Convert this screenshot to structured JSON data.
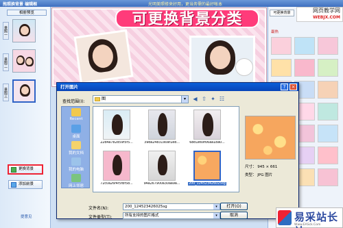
{
  "app": {
    "title": "拖照换背景 编辑框",
    "notice": "光明美照修来好用，更当务需的最好帐本"
  },
  "left_panel": {
    "header": "相册预览",
    "items": [
      {
        "label": "景照一"
      },
      {
        "label": "景照二"
      },
      {
        "label": "景照三"
      }
    ],
    "change_bg_button": "更换背景",
    "add_bg_button": "添加前景",
    "feedback_link": "提意见"
  },
  "banner_text": "可更换背景分类",
  "right_panel": {
    "tab_label": "可更换背景",
    "category_label": "最热"
  },
  "watermark": {
    "top_title": "网页教学网",
    "top_url": "WEBJX.COM",
    "bottom_name": "易采站长站",
    "bottom_url": "Www.EASck.Com"
  },
  "dialog": {
    "title": "打开图片",
    "help": "?",
    "close": "×",
    "look_in_label": "查找范围(I):",
    "look_in_value": "图",
    "places": [
      "Recent",
      "桌面",
      "我的文档",
      "我的电脑",
      "网上邻居"
    ],
    "files": [
      {
        "name": "22d4a782d59f5f5..."
      },
      {
        "name": "39da2483190af1e8..."
      },
      {
        "name": "68d1e69f06aa18a0..."
      },
      {
        "name": "72c0a26f4f5fbf5b..."
      },
      {
        "name": "94a267900a30aa9a..."
      },
      {
        "name": "200_124523426025sg"
      }
    ],
    "preview": {
      "size_label": "尺寸：",
      "size_value": "945 × 661",
      "type_label": "类型：",
      "type_value": "JPG 图片"
    },
    "filename_label": "文件名(N):",
    "filename_value": "200_124523426025sg",
    "filetype_label": "文件类型(T):",
    "filetype_value": "所有支持的图片格式",
    "open_button": "打开(O)",
    "cancel_button": "取消"
  }
}
